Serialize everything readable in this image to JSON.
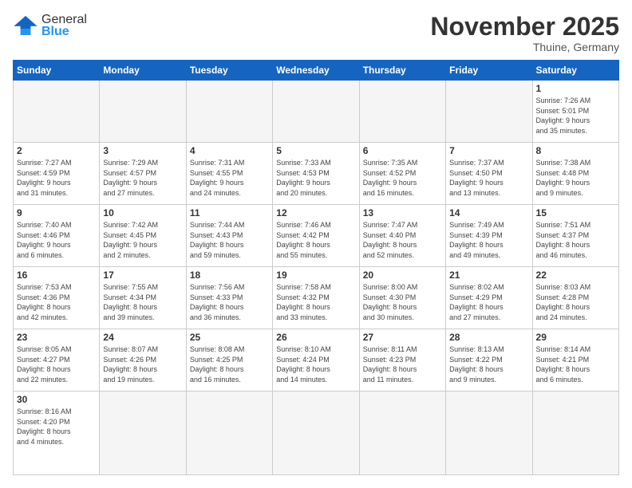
{
  "header": {
    "logo_general": "General",
    "logo_blue": "Blue",
    "title": "November 2025",
    "subtitle": "Thuine, Germany"
  },
  "days_of_week": [
    "Sunday",
    "Monday",
    "Tuesday",
    "Wednesday",
    "Thursday",
    "Friday",
    "Saturday"
  ],
  "weeks": [
    [
      {
        "day": "",
        "info": ""
      },
      {
        "day": "",
        "info": ""
      },
      {
        "day": "",
        "info": ""
      },
      {
        "day": "",
        "info": ""
      },
      {
        "day": "",
        "info": ""
      },
      {
        "day": "",
        "info": ""
      },
      {
        "day": "1",
        "info": "Sunrise: 7:26 AM\nSunset: 5:01 PM\nDaylight: 9 hours\nand 35 minutes."
      }
    ],
    [
      {
        "day": "2",
        "info": "Sunrise: 7:27 AM\nSunset: 4:59 PM\nDaylight: 9 hours\nand 31 minutes."
      },
      {
        "day": "3",
        "info": "Sunrise: 7:29 AM\nSunset: 4:57 PM\nDaylight: 9 hours\nand 27 minutes."
      },
      {
        "day": "4",
        "info": "Sunrise: 7:31 AM\nSunset: 4:55 PM\nDaylight: 9 hours\nand 24 minutes."
      },
      {
        "day": "5",
        "info": "Sunrise: 7:33 AM\nSunset: 4:53 PM\nDaylight: 9 hours\nand 20 minutes."
      },
      {
        "day": "6",
        "info": "Sunrise: 7:35 AM\nSunset: 4:52 PM\nDaylight: 9 hours\nand 16 minutes."
      },
      {
        "day": "7",
        "info": "Sunrise: 7:37 AM\nSunset: 4:50 PM\nDaylight: 9 hours\nand 13 minutes."
      },
      {
        "day": "8",
        "info": "Sunrise: 7:38 AM\nSunset: 4:48 PM\nDaylight: 9 hours\nand 9 minutes."
      }
    ],
    [
      {
        "day": "9",
        "info": "Sunrise: 7:40 AM\nSunset: 4:46 PM\nDaylight: 9 hours\nand 6 minutes."
      },
      {
        "day": "10",
        "info": "Sunrise: 7:42 AM\nSunset: 4:45 PM\nDaylight: 9 hours\nand 2 minutes."
      },
      {
        "day": "11",
        "info": "Sunrise: 7:44 AM\nSunset: 4:43 PM\nDaylight: 8 hours\nand 59 minutes."
      },
      {
        "day": "12",
        "info": "Sunrise: 7:46 AM\nSunset: 4:42 PM\nDaylight: 8 hours\nand 55 minutes."
      },
      {
        "day": "13",
        "info": "Sunrise: 7:47 AM\nSunset: 4:40 PM\nDaylight: 8 hours\nand 52 minutes."
      },
      {
        "day": "14",
        "info": "Sunrise: 7:49 AM\nSunset: 4:39 PM\nDaylight: 8 hours\nand 49 minutes."
      },
      {
        "day": "15",
        "info": "Sunrise: 7:51 AM\nSunset: 4:37 PM\nDaylight: 8 hours\nand 46 minutes."
      }
    ],
    [
      {
        "day": "16",
        "info": "Sunrise: 7:53 AM\nSunset: 4:36 PM\nDaylight: 8 hours\nand 42 minutes."
      },
      {
        "day": "17",
        "info": "Sunrise: 7:55 AM\nSunset: 4:34 PM\nDaylight: 8 hours\nand 39 minutes."
      },
      {
        "day": "18",
        "info": "Sunrise: 7:56 AM\nSunset: 4:33 PM\nDaylight: 8 hours\nand 36 minutes."
      },
      {
        "day": "19",
        "info": "Sunrise: 7:58 AM\nSunset: 4:32 PM\nDaylight: 8 hours\nand 33 minutes."
      },
      {
        "day": "20",
        "info": "Sunrise: 8:00 AM\nSunset: 4:30 PM\nDaylight: 8 hours\nand 30 minutes."
      },
      {
        "day": "21",
        "info": "Sunrise: 8:02 AM\nSunset: 4:29 PM\nDaylight: 8 hours\nand 27 minutes."
      },
      {
        "day": "22",
        "info": "Sunrise: 8:03 AM\nSunset: 4:28 PM\nDaylight: 8 hours\nand 24 minutes."
      }
    ],
    [
      {
        "day": "23",
        "info": "Sunrise: 8:05 AM\nSunset: 4:27 PM\nDaylight: 8 hours\nand 22 minutes."
      },
      {
        "day": "24",
        "info": "Sunrise: 8:07 AM\nSunset: 4:26 PM\nDaylight: 8 hours\nand 19 minutes."
      },
      {
        "day": "25",
        "info": "Sunrise: 8:08 AM\nSunset: 4:25 PM\nDaylight: 8 hours\nand 16 minutes."
      },
      {
        "day": "26",
        "info": "Sunrise: 8:10 AM\nSunset: 4:24 PM\nDaylight: 8 hours\nand 14 minutes."
      },
      {
        "day": "27",
        "info": "Sunrise: 8:11 AM\nSunset: 4:23 PM\nDaylight: 8 hours\nand 11 minutes."
      },
      {
        "day": "28",
        "info": "Sunrise: 8:13 AM\nSunset: 4:22 PM\nDaylight: 8 hours\nand 9 minutes."
      },
      {
        "day": "29",
        "info": "Sunrise: 8:14 AM\nSunset: 4:21 PM\nDaylight: 8 hours\nand 6 minutes."
      }
    ],
    [
      {
        "day": "30",
        "info": "Sunrise: 8:16 AM\nSunset: 4:20 PM\nDaylight: 8 hours\nand 4 minutes."
      },
      {
        "day": "",
        "info": ""
      },
      {
        "day": "",
        "info": ""
      },
      {
        "day": "",
        "info": ""
      },
      {
        "day": "",
        "info": ""
      },
      {
        "day": "",
        "info": ""
      },
      {
        "day": "",
        "info": ""
      }
    ]
  ]
}
